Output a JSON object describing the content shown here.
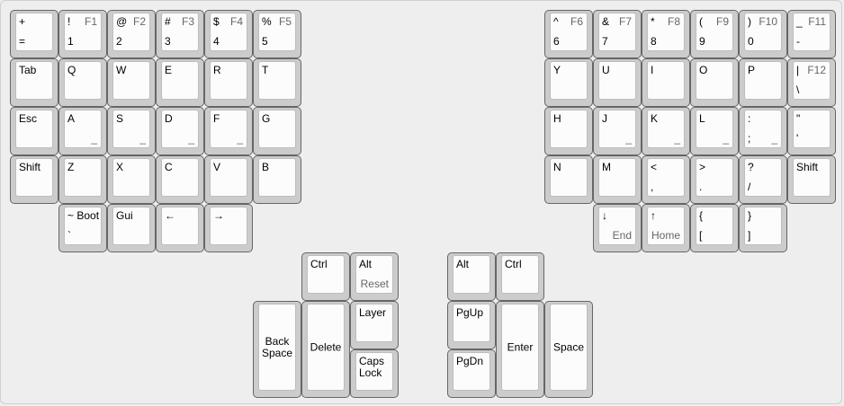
{
  "keyboard": {
    "keys": [
      {
        "id": "plus",
        "tl": "+",
        "bl": "="
      },
      {
        "id": "1",
        "tl": "!",
        "tr": "F1",
        "bl": "1"
      },
      {
        "id": "2",
        "tl": "@",
        "tr": "F2",
        "bl": "2"
      },
      {
        "id": "3",
        "tl": "#",
        "tr": "F3",
        "bl": "3"
      },
      {
        "id": "4",
        "tl": "$",
        "tr": "F4",
        "bl": "4"
      },
      {
        "id": "5",
        "tl": "%",
        "tr": "F5",
        "bl": "5"
      },
      {
        "id": "tab",
        "tl": "Tab"
      },
      {
        "id": "q",
        "tl": "Q"
      },
      {
        "id": "w",
        "tl": "W"
      },
      {
        "id": "e",
        "tl": "E"
      },
      {
        "id": "r",
        "tl": "R"
      },
      {
        "id": "t",
        "tl": "T"
      },
      {
        "id": "esc",
        "tl": "Esc"
      },
      {
        "id": "a",
        "tl": "A",
        "br": "_"
      },
      {
        "id": "s",
        "tl": "S",
        "br": "_"
      },
      {
        "id": "d",
        "tl": "D",
        "br": "_"
      },
      {
        "id": "f",
        "tl": "F",
        "br": "_"
      },
      {
        "id": "g",
        "tl": "G"
      },
      {
        "id": "shift-left",
        "tl": "Shift"
      },
      {
        "id": "z",
        "tl": "Z"
      },
      {
        "id": "x",
        "tl": "X"
      },
      {
        "id": "c",
        "tl": "C"
      },
      {
        "id": "v",
        "tl": "V"
      },
      {
        "id": "b",
        "tl": "B"
      },
      {
        "id": "tilde",
        "tl": "~ Boot",
        "bl": "`"
      },
      {
        "id": "gui",
        "tl": "Gui"
      },
      {
        "id": "arrow-left",
        "tl": "←"
      },
      {
        "id": "arrow-right",
        "tl": "→"
      },
      {
        "id": "6",
        "tl": "^",
        "tr": "F6",
        "bl": "6"
      },
      {
        "id": "7",
        "tl": "&",
        "tr": "F7",
        "bl": "7"
      },
      {
        "id": "8",
        "tl": "*",
        "tr": "F8",
        "bl": "8"
      },
      {
        "id": "9",
        "tl": "(",
        "tr": "F9",
        "bl": "9"
      },
      {
        "id": "0",
        "tl": ")",
        "tr": "F10",
        "bl": "0"
      },
      {
        "id": "minus",
        "tl": "_",
        "tr": "F11",
        "bl": "-"
      },
      {
        "id": "y",
        "tl": "Y"
      },
      {
        "id": "u",
        "tl": "U"
      },
      {
        "id": "i",
        "tl": "I"
      },
      {
        "id": "o",
        "tl": "O"
      },
      {
        "id": "p",
        "tl": "P"
      },
      {
        "id": "pipe",
        "tl": "|",
        "tr": "F12",
        "bl": "\\"
      },
      {
        "id": "h",
        "tl": "H"
      },
      {
        "id": "j",
        "tl": "J",
        "br": "_"
      },
      {
        "id": "k",
        "tl": "K",
        "br": "_"
      },
      {
        "id": "l",
        "tl": "L",
        "br": "_"
      },
      {
        "id": "semicolon",
        "tl": ":",
        "bl": ";",
        "br": "_"
      },
      {
        "id": "quote",
        "tl": "\"",
        "bl": "'"
      },
      {
        "id": "n",
        "tl": "N"
      },
      {
        "id": "m",
        "tl": "M"
      },
      {
        "id": "comma",
        "tl": "<",
        "bl": ","
      },
      {
        "id": "period",
        "tl": ">",
        "bl": "."
      },
      {
        "id": "slash",
        "tl": "?",
        "bl": "/"
      },
      {
        "id": "shift-right",
        "tl": "Shift"
      },
      {
        "id": "arrow-down",
        "tl": "↓",
        "br": "End"
      },
      {
        "id": "arrow-up",
        "tl": "↑",
        "br": "Home"
      },
      {
        "id": "bracket-left",
        "tl": "{",
        "bl": "["
      },
      {
        "id": "bracket-right",
        "tl": "}",
        "bl": "]"
      },
      {
        "id": "ctrl-left",
        "tl": "Ctrl"
      },
      {
        "id": "alt-left",
        "tl": "Alt",
        "br": "Reset"
      },
      {
        "id": "backspace",
        "c": "Back\nSpace"
      },
      {
        "id": "delete",
        "c": "Delete"
      },
      {
        "id": "layer",
        "tlm": "Layer"
      },
      {
        "id": "capslock",
        "tlm": "Caps\nLock"
      },
      {
        "id": "alt-right",
        "tl": "Alt"
      },
      {
        "id": "ctrl-right",
        "tl": "Ctrl"
      },
      {
        "id": "pgup",
        "tl": "PgUp"
      },
      {
        "id": "pgdn",
        "tl": "PgDn"
      },
      {
        "id": "enter",
        "c": "Enter"
      },
      {
        "id": "space",
        "c": "Space"
      }
    ]
  }
}
